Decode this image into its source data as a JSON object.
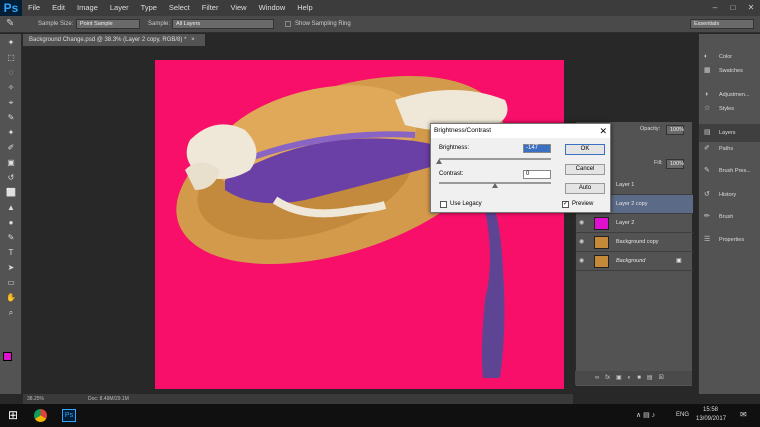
{
  "app": {
    "logo": "Ps"
  },
  "menu": [
    "File",
    "Edit",
    "Image",
    "Layer",
    "Type",
    "Select",
    "Filter",
    "View",
    "Window",
    "Help"
  ],
  "window_controls": [
    "–",
    "□",
    "✕"
  ],
  "options": {
    "sample_size_label": "Sample Size:",
    "sample_size_value": "Point Sample",
    "sample_label": "Sample:",
    "sample_value": "All Layers",
    "show_ring": "Show Sampling Ring",
    "workspace": "Essentials"
  },
  "document": {
    "tab_title": "Background Change.psd @ 38.3% (Layer 2 copy, RGB/8) *",
    "tab_close": "×"
  },
  "status": {
    "zoom": "38.25%",
    "doc": "Doc: 8.49M/29.1M"
  },
  "layers_panel": {
    "opacity_label": "Opacity:",
    "opacity_value": "100%",
    "fill_label": "Fill:",
    "fill_value": "100%",
    "layers": [
      {
        "name": "Layer 1",
        "thumb": "#5a8fd6"
      },
      {
        "name": "Layer 2 copy",
        "thumb": "#3a3a3a"
      },
      {
        "name": "Layer 2",
        "thumb": "#e010d0"
      },
      {
        "name": "Background copy",
        "thumb": "#c48a3a"
      },
      {
        "name": "Background",
        "thumb": "#c48a3a"
      }
    ],
    "footer_icons": [
      "∞",
      "fx",
      "▣",
      "◐",
      "■",
      "▤",
      "☒"
    ]
  },
  "right_panel": {
    "items": [
      "Color",
      "Swatches",
      "Adjustmen...",
      "Styles",
      "Layers",
      "Paths",
      "Brush Pres...",
      "History",
      "Brush",
      "Properties"
    ],
    "icons": [
      "◐",
      "▦",
      "◑",
      "☆",
      "▤",
      "✐",
      "✎",
      "↺",
      "✏",
      "☰"
    ]
  },
  "dialog": {
    "title": "Brightness/Contrast",
    "close": "✕",
    "brightness_label": "Brightness:",
    "brightness_value": "-147",
    "contrast_label": "Contrast:",
    "contrast_value": "0",
    "ok": "OK",
    "cancel": "Cancel",
    "auto": "Auto",
    "legacy_label": "Use Legacy",
    "preview_label": "Preview",
    "preview_checked": "✓",
    "brightness_position": 0.0,
    "contrast_position": 0.5
  },
  "taskbar": {
    "language": "ENG",
    "time": "15:58",
    "date": "13/09/2017",
    "apps": [
      "Chrome",
      "Ps"
    ]
  },
  "tools": [
    "✦",
    "⬚",
    "◌",
    "✧",
    "⌖",
    "✎",
    "✦",
    "✐",
    "▣",
    "↺",
    "⬜",
    "▲",
    "●",
    "✎",
    "T",
    "➤",
    "▭",
    "✋",
    "⌕"
  ],
  "colors": {
    "accent": "#f80f69",
    "foreground": "#e010d0",
    "background_swatch": "#ffffff",
    "selected_layer": "#5b6a86"
  }
}
